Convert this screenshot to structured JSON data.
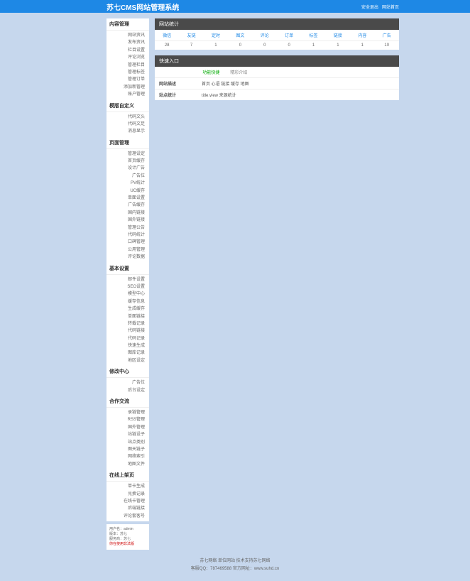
{
  "header": {
    "title": "苏七CMS网站管理系统",
    "links": [
      "安全退出",
      "网站首页"
    ]
  },
  "sidebar": {
    "sections": [
      {
        "title": "内容管理",
        "items": [
          "网站资讯",
          "发布资讯",
          "栏目设置",
          "评论浏览",
          "管理栏目",
          "管理标签",
          "管理订单",
          "添加新管理",
          "账户管理"
        ]
      },
      {
        "title": "模版自定义",
        "items": [
          "代码文头",
          "代码文足",
          "消息显示"
        ]
      },
      {
        "title": "页面管理",
        "items": [
          "管理设定",
          "首页缓存",
          "设计广告",
          "广告位",
          "PV统计",
          "UC缓存",
          "单面设置",
          "广告缓存",
          "国内链接",
          "国外链接",
          "管理公告",
          "代码统计",
          "口碑管理",
          "公用管理",
          "评论数据"
        ]
      },
      {
        "title": "基本设置",
        "items": [
          "邮件设置",
          "SEO设置",
          "模型中心",
          "缓存信息",
          "生成缓存",
          "单面链接",
          "转载记录",
          "代码链接",
          "代码记录",
          "快速生成",
          "图库记录",
          "地区设定"
        ]
      },
      {
        "title": "修改中心",
        "items": [
          "广告位",
          "后台设定"
        ]
      },
      {
        "title": "合作交流",
        "items": [
          "录链管理",
          "RSS管理",
          "国外管理",
          "站链设子",
          "站点类别",
          "图天链子",
          "网络索引",
          "地图文件"
        ]
      },
      {
        "title": "在线上架页",
        "items": [
          "单卡生成",
          "兑换记录",
          "在线卡管理",
          "后端链接",
          "评论套客号"
        ]
      }
    ],
    "info": {
      "user_label": "用户名：",
      "user": "admin",
      "ver_label": "版本：",
      "ver": "苏七",
      "isp_label": "服务商：",
      "isp": "苏七",
      "warn": "你在使用非法版"
    }
  },
  "stats": {
    "title": "网站统计",
    "headers": [
      "微信",
      "友链",
      "定时",
      "图文",
      "评论",
      "订单",
      "标签",
      "链接",
      "内容",
      "广告"
    ],
    "values": [
      "28",
      "7",
      "1",
      "0",
      "0",
      "0",
      "1",
      "1",
      "1",
      "10"
    ]
  },
  "entry": {
    "title": "快速入口",
    "tabs": [
      "功能快捷",
      "精彩介绍"
    ],
    "rows": [
      {
        "label": "网站描述",
        "value": "首页 心语 链接 缓存 地图"
      },
      {
        "label": "站点统计",
        "value": "title.view 来源统计"
      }
    ]
  },
  "footer": {
    "line1": "苏七网络 单位网站 技术支持苏七网络",
    "line2": "客服QQ：787469588 官方网址：www.suhd.cn"
  }
}
